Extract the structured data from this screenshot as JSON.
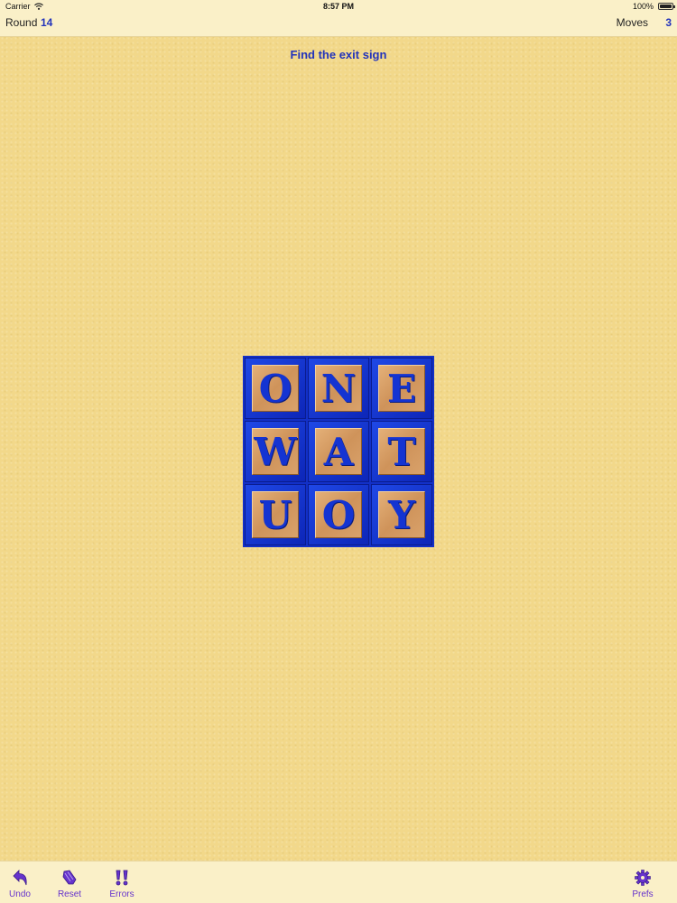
{
  "status_bar": {
    "carrier": "Carrier",
    "time": "8:57 PM",
    "battery": "100%",
    "wifi_icon": "wifi-icon",
    "battery_icon": "battery-icon"
  },
  "header": {
    "round_label": "Round",
    "round_value": "14",
    "moves_label": "Moves",
    "moves_value": "3"
  },
  "hint": "Find the exit sign",
  "board": {
    "rows": [
      [
        "O",
        "N",
        "E"
      ],
      [
        "W",
        "A",
        "T"
      ],
      [
        "U",
        "O",
        "Y"
      ]
    ],
    "tile_color": "#1434d2",
    "frame_color": "#1230c8"
  },
  "toolbar": {
    "undo": {
      "label": "Undo",
      "icon": "undo-icon"
    },
    "reset": {
      "label": "Reset",
      "icon": "reset-icon"
    },
    "errors": {
      "label": "Errors",
      "icon": "errors-icon"
    },
    "prefs": {
      "label": "Prefs",
      "icon": "gear-icon"
    },
    "accent": "#6633cc"
  }
}
